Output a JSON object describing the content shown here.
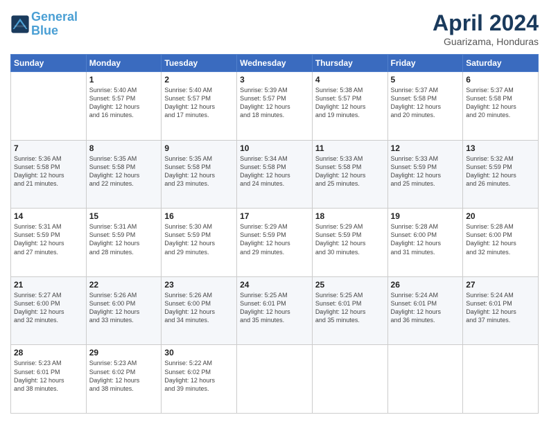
{
  "header": {
    "logo_line1": "General",
    "logo_line2": "Blue",
    "month_title": "April 2024",
    "location": "Guarizama, Honduras"
  },
  "weekdays": [
    "Sunday",
    "Monday",
    "Tuesday",
    "Wednesday",
    "Thursday",
    "Friday",
    "Saturday"
  ],
  "weeks": [
    [
      {
        "day": "",
        "info": ""
      },
      {
        "day": "1",
        "info": "Sunrise: 5:40 AM\nSunset: 5:57 PM\nDaylight: 12 hours\nand 16 minutes."
      },
      {
        "day": "2",
        "info": "Sunrise: 5:40 AM\nSunset: 5:57 PM\nDaylight: 12 hours\nand 17 minutes."
      },
      {
        "day": "3",
        "info": "Sunrise: 5:39 AM\nSunset: 5:57 PM\nDaylight: 12 hours\nand 18 minutes."
      },
      {
        "day": "4",
        "info": "Sunrise: 5:38 AM\nSunset: 5:57 PM\nDaylight: 12 hours\nand 19 minutes."
      },
      {
        "day": "5",
        "info": "Sunrise: 5:37 AM\nSunset: 5:58 PM\nDaylight: 12 hours\nand 20 minutes."
      },
      {
        "day": "6",
        "info": "Sunrise: 5:37 AM\nSunset: 5:58 PM\nDaylight: 12 hours\nand 20 minutes."
      }
    ],
    [
      {
        "day": "7",
        "info": "Sunrise: 5:36 AM\nSunset: 5:58 PM\nDaylight: 12 hours\nand 21 minutes."
      },
      {
        "day": "8",
        "info": "Sunrise: 5:35 AM\nSunset: 5:58 PM\nDaylight: 12 hours\nand 22 minutes."
      },
      {
        "day": "9",
        "info": "Sunrise: 5:35 AM\nSunset: 5:58 PM\nDaylight: 12 hours\nand 23 minutes."
      },
      {
        "day": "10",
        "info": "Sunrise: 5:34 AM\nSunset: 5:58 PM\nDaylight: 12 hours\nand 24 minutes."
      },
      {
        "day": "11",
        "info": "Sunrise: 5:33 AM\nSunset: 5:58 PM\nDaylight: 12 hours\nand 25 minutes."
      },
      {
        "day": "12",
        "info": "Sunrise: 5:33 AM\nSunset: 5:59 PM\nDaylight: 12 hours\nand 25 minutes."
      },
      {
        "day": "13",
        "info": "Sunrise: 5:32 AM\nSunset: 5:59 PM\nDaylight: 12 hours\nand 26 minutes."
      }
    ],
    [
      {
        "day": "14",
        "info": "Sunrise: 5:31 AM\nSunset: 5:59 PM\nDaylight: 12 hours\nand 27 minutes."
      },
      {
        "day": "15",
        "info": "Sunrise: 5:31 AM\nSunset: 5:59 PM\nDaylight: 12 hours\nand 28 minutes."
      },
      {
        "day": "16",
        "info": "Sunrise: 5:30 AM\nSunset: 5:59 PM\nDaylight: 12 hours\nand 29 minutes."
      },
      {
        "day": "17",
        "info": "Sunrise: 5:29 AM\nSunset: 5:59 PM\nDaylight: 12 hours\nand 29 minutes."
      },
      {
        "day": "18",
        "info": "Sunrise: 5:29 AM\nSunset: 5:59 PM\nDaylight: 12 hours\nand 30 minutes."
      },
      {
        "day": "19",
        "info": "Sunrise: 5:28 AM\nSunset: 6:00 PM\nDaylight: 12 hours\nand 31 minutes."
      },
      {
        "day": "20",
        "info": "Sunrise: 5:28 AM\nSunset: 6:00 PM\nDaylight: 12 hours\nand 32 minutes."
      }
    ],
    [
      {
        "day": "21",
        "info": "Sunrise: 5:27 AM\nSunset: 6:00 PM\nDaylight: 12 hours\nand 32 minutes."
      },
      {
        "day": "22",
        "info": "Sunrise: 5:26 AM\nSunset: 6:00 PM\nDaylight: 12 hours\nand 33 minutes."
      },
      {
        "day": "23",
        "info": "Sunrise: 5:26 AM\nSunset: 6:00 PM\nDaylight: 12 hours\nand 34 minutes."
      },
      {
        "day": "24",
        "info": "Sunrise: 5:25 AM\nSunset: 6:01 PM\nDaylight: 12 hours\nand 35 minutes."
      },
      {
        "day": "25",
        "info": "Sunrise: 5:25 AM\nSunset: 6:01 PM\nDaylight: 12 hours\nand 35 minutes."
      },
      {
        "day": "26",
        "info": "Sunrise: 5:24 AM\nSunset: 6:01 PM\nDaylight: 12 hours\nand 36 minutes."
      },
      {
        "day": "27",
        "info": "Sunrise: 5:24 AM\nSunset: 6:01 PM\nDaylight: 12 hours\nand 37 minutes."
      }
    ],
    [
      {
        "day": "28",
        "info": "Sunrise: 5:23 AM\nSunset: 6:01 PM\nDaylight: 12 hours\nand 38 minutes."
      },
      {
        "day": "29",
        "info": "Sunrise: 5:23 AM\nSunset: 6:02 PM\nDaylight: 12 hours\nand 38 minutes."
      },
      {
        "day": "30",
        "info": "Sunrise: 5:22 AM\nSunset: 6:02 PM\nDaylight: 12 hours\nand 39 minutes."
      },
      {
        "day": "",
        "info": ""
      },
      {
        "day": "",
        "info": ""
      },
      {
        "day": "",
        "info": ""
      },
      {
        "day": "",
        "info": ""
      }
    ]
  ]
}
